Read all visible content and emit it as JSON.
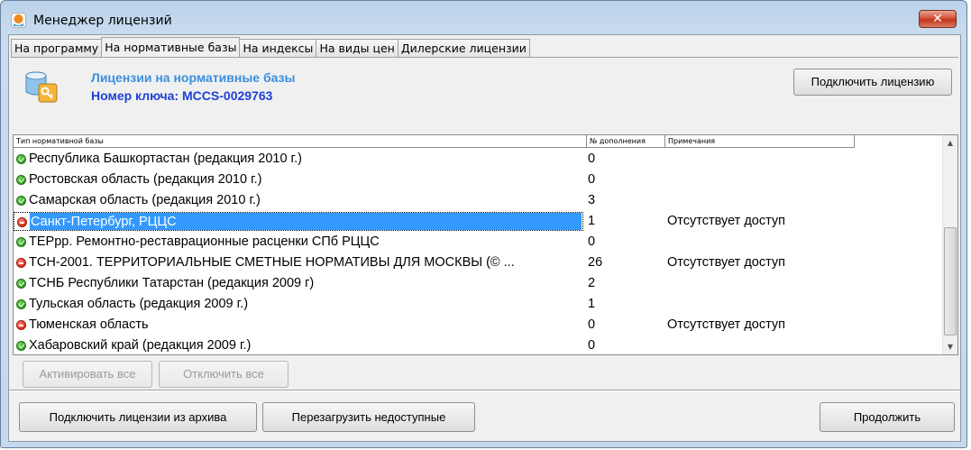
{
  "window": {
    "title": "Менеджер лицензий",
    "close_glyph": "✕"
  },
  "tabs": [
    {
      "label": "На программу",
      "active": false
    },
    {
      "label": "На нормативные базы",
      "active": true
    },
    {
      "label": "На индексы",
      "active": false
    },
    {
      "label": "На виды цен",
      "active": false
    },
    {
      "label": "Дилерские лицензии",
      "active": false
    }
  ],
  "header": {
    "title": "Лицензии на нормативные базы",
    "key_label": "Номер ключа: MCCS-0029763",
    "connect_button": "Подключить лицензию"
  },
  "table": {
    "columns": [
      "Тип нормативной базы",
      "№ дополнения",
      "Примечания"
    ],
    "rows": [
      {
        "status": "ok",
        "name": "Республика Башкортастан (редакция 2010 г.)",
        "num": "0",
        "note": ""
      },
      {
        "status": "ok",
        "name": "Ростовская область  (редакция 2010 г.)",
        "num": "0",
        "note": ""
      },
      {
        "status": "ok",
        "name": "Самарская область (редакция 2010 г.)",
        "num": "3",
        "note": ""
      },
      {
        "status": "no",
        "name": "Санкт-Петербург, РЦЦС",
        "num": "1",
        "note": "Отсутствует доступ",
        "selected": true
      },
      {
        "status": "ok",
        "name": "ТЕРрр. Ремонтно-реставрационные расценки СПб РЦЦС",
        "num": "0",
        "note": ""
      },
      {
        "status": "no",
        "name": "ТСН-2001. ТЕРРИТОРИАЛЬНЫЕ СМЕТНЫЕ НОРМАТИВЫ ДЛЯ МОСКВЫ (© ...",
        "num": "26",
        "note": "Отсутствует доступ"
      },
      {
        "status": "ok",
        "name": "ТСНБ Республики Татарстан (редакция 2009 г)",
        "num": "2",
        "note": ""
      },
      {
        "status": "ok",
        "name": "Тульская область (редакция 2009 г.)",
        "num": "1",
        "note": ""
      },
      {
        "status": "no",
        "name": "Тюменская область",
        "num": "0",
        "note": "Отсутствует доступ"
      },
      {
        "status": "ok",
        "name": "Хабаровский край  (редакция 2009 г.)",
        "num": "0",
        "note": ""
      }
    ]
  },
  "table_actions": {
    "activate_all": "Активировать все",
    "disable_all": "Отключить все"
  },
  "footer": {
    "archive_button": "Подключить лицензии из архива",
    "reload_button": "Перезагрузить недоступные",
    "continue_button": "Продолжить"
  },
  "scrollbar": {
    "up_glyph": "▲",
    "down_glyph": "▼"
  },
  "icons": {
    "app": "app-orange-icon",
    "database_key": "database-key-icon",
    "ok": "check-icon",
    "no": "no-entry-icon"
  }
}
